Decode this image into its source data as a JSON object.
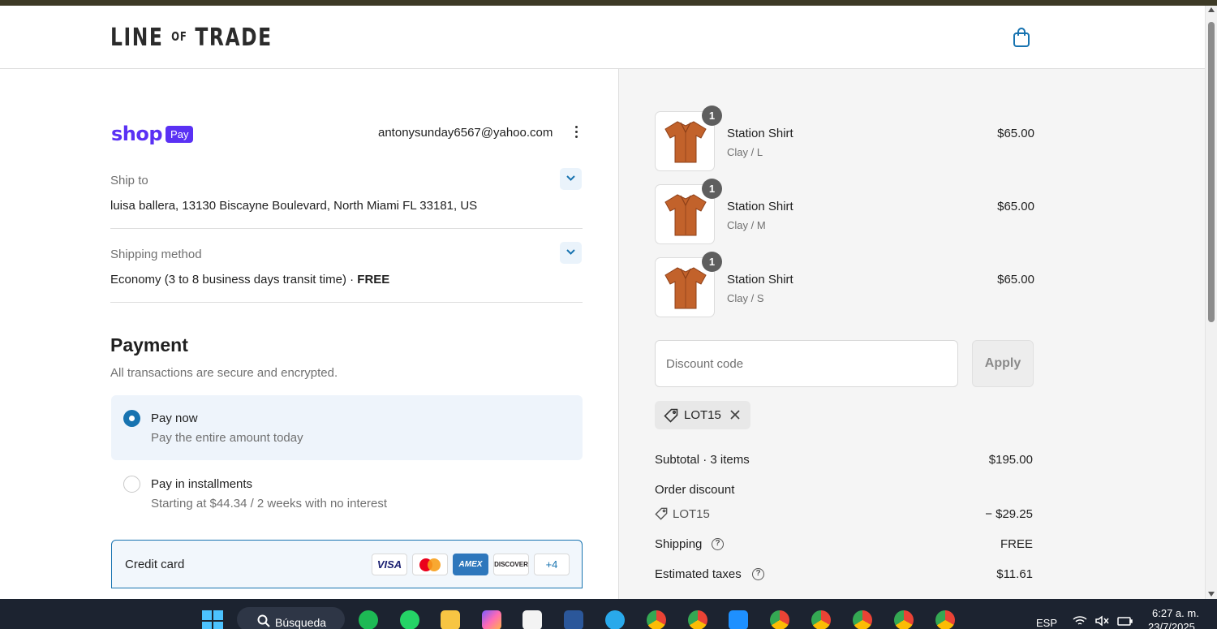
{
  "header": {
    "brand_main": "LINE",
    "brand_of": "OF",
    "brand_end": "TRADE",
    "cart_icon": "shopping-bag-icon"
  },
  "account": {
    "shop_word": "shop",
    "pay_badge": "Pay",
    "email": "antonysunday6567@yahoo.com",
    "menu_icon": "kebab-menu-icon"
  },
  "ship_to": {
    "label": "Ship to",
    "value": "luisa ballera, 13130 Biscayne Boulevard, North Miami FL 33181, US"
  },
  "shipping_method": {
    "label": "Shipping method",
    "value": "Economy (3 to 8 business days transit time) · ",
    "price": "FREE"
  },
  "payment": {
    "title": "Payment",
    "subtitle": "All transactions are secure and encrypted.",
    "options": [
      {
        "title": "Pay now",
        "subtitle": "Pay the entire amount today",
        "selected": true
      },
      {
        "title": "Pay in installments",
        "subtitle": "Starting at $44.34 / 2 weeks with no interest",
        "selected": false
      }
    ],
    "credit_card": {
      "label": "Credit card",
      "brands": [
        "VISA",
        "mastercard",
        "AMEX",
        "DISCOVER"
      ],
      "more": "+4"
    }
  },
  "cart": {
    "items": [
      {
        "name": "Station Shirt",
        "variant": "Clay / L",
        "price": "$65.00",
        "qty": "1"
      },
      {
        "name": "Station Shirt",
        "variant": "Clay / M",
        "price": "$65.00",
        "qty": "1"
      },
      {
        "name": "Station Shirt",
        "variant": "Clay / S",
        "price": "$65.00",
        "qty": "1"
      }
    ],
    "discount": {
      "placeholder": "Discount code",
      "apply_label": "Apply",
      "applied_code": "LOT15"
    },
    "summary": {
      "subtotal_label": "Subtotal · 3 items",
      "subtotal_value": "$195.00",
      "order_discount_label": "Order discount",
      "discount_code": "LOT15",
      "discount_value": "− $29.25",
      "shipping_label": "Shipping",
      "shipping_value": "FREE",
      "taxes_label": "Estimated taxes",
      "taxes_value": "$11.61"
    }
  },
  "taskbar": {
    "search_label": "Búsqueda",
    "language": "ESP",
    "time": "6:27 a. m.",
    "date": "23/7/2025"
  },
  "colors": {
    "accent": "#1773b0",
    "shop_purple": "#5a31f4",
    "shirt": "#c2622b"
  }
}
